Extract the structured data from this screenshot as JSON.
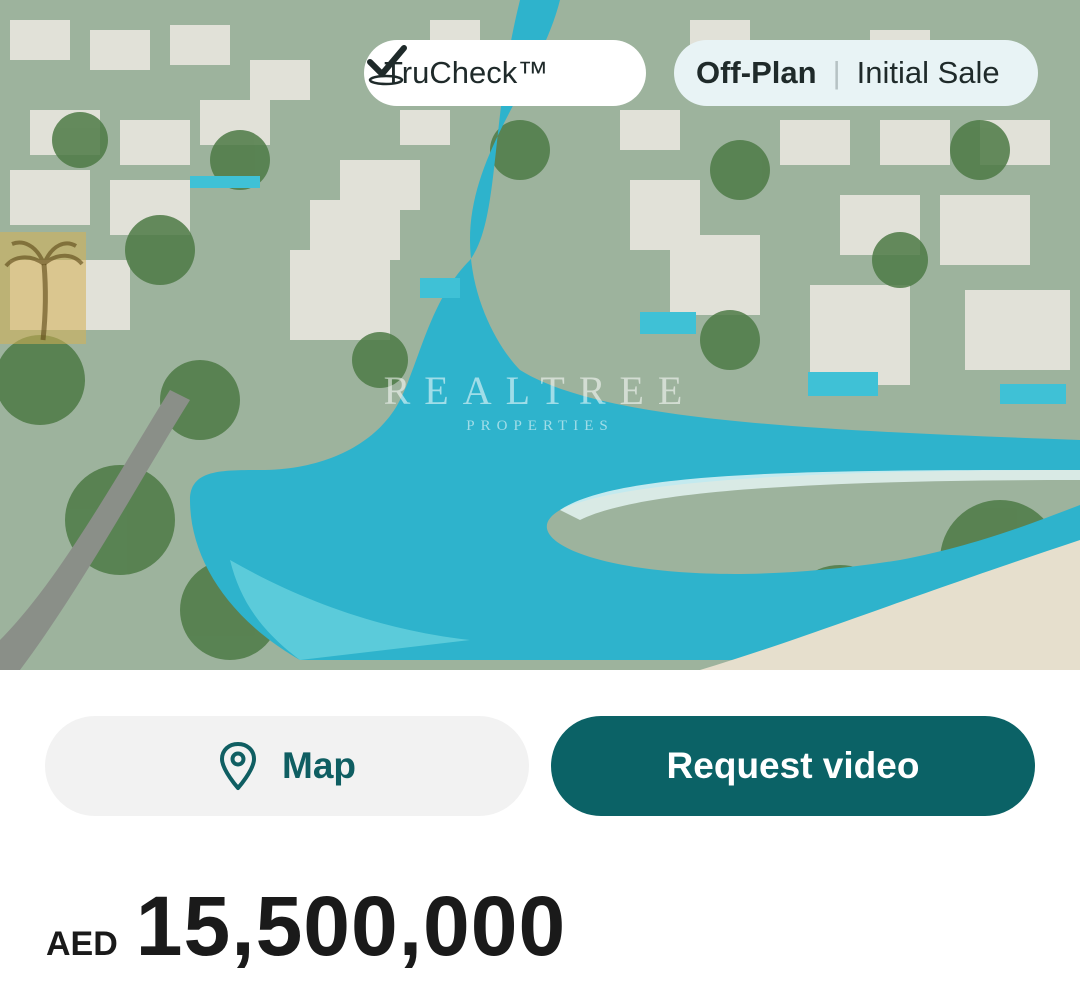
{
  "hero": {
    "image_alt": "Aerial rendering of villa community with lagoon",
    "watermark_name": "REALTREE",
    "watermark_sub": "PROPERTIES"
  },
  "badges": {
    "trucheck": "TruCheck™",
    "status_primary": "Off-Plan",
    "status_secondary": "Initial Sale"
  },
  "actions": {
    "map_label": "Map",
    "request_video_label": "Request video"
  },
  "price": {
    "currency": "AED",
    "amount": "15,500,000"
  },
  "colors": {
    "accent": "#0b6266",
    "map_button_bg": "#f2f2f2",
    "status_badge_bg": "#e8f3f5"
  },
  "icons": {
    "trucheck": "check-icon",
    "map": "location-pin-icon"
  }
}
